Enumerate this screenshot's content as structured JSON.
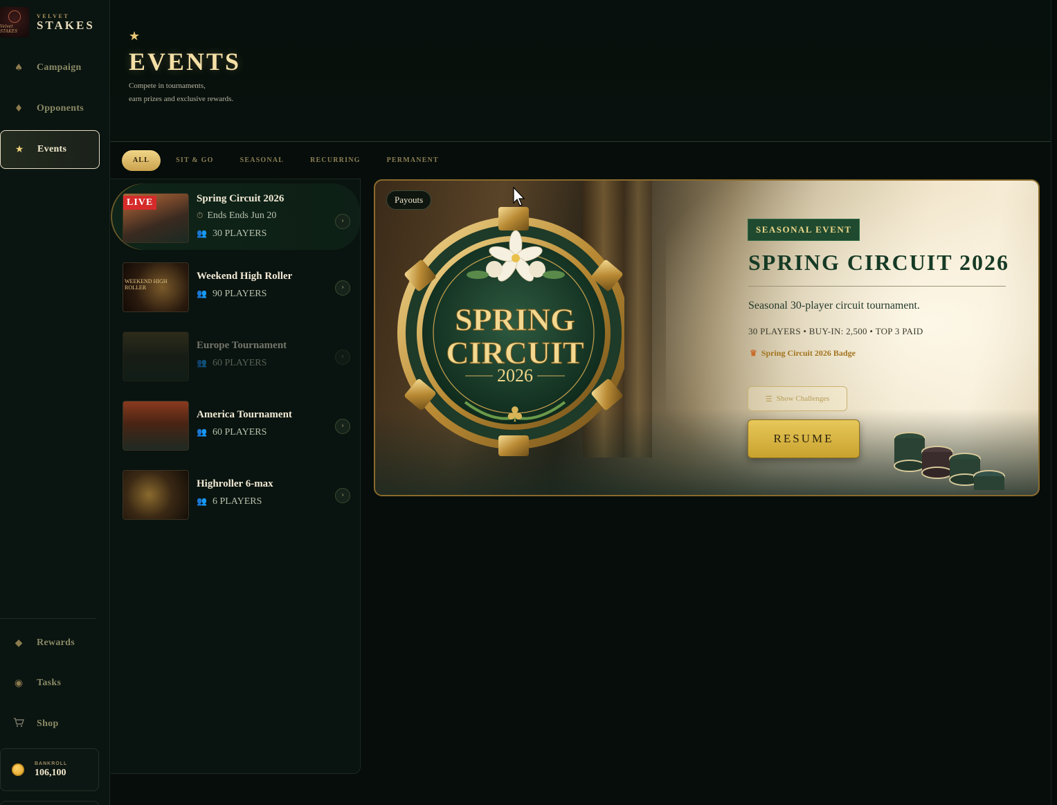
{
  "brand": {
    "sub": "VELVET",
    "main": "STAKES",
    "logo_text": "Velvet STAKES"
  },
  "nav": {
    "top": [
      {
        "label": "Campaign",
        "icon": "spade-icon"
      },
      {
        "label": "Opponents",
        "icon": "diamond-icon"
      },
      {
        "label": "Events",
        "icon": "star-icon",
        "active": true
      }
    ],
    "bottom": [
      {
        "label": "Rewards",
        "icon": "gem-icon"
      },
      {
        "label": "Tasks",
        "icon": "target-icon"
      },
      {
        "label": "Shop",
        "icon": "cart-icon"
      }
    ]
  },
  "bankroll": {
    "label": "BANKROLL",
    "value": "106,100"
  },
  "header": {
    "title": "EVENTS",
    "subtitle_line1": "Compete in tournaments,",
    "subtitle_line2": "earn prizes and exclusive rewards."
  },
  "tabs": [
    {
      "label": "ALL",
      "active": true
    },
    {
      "label": "SIT & GO"
    },
    {
      "label": "SEASONAL"
    },
    {
      "label": "RECURRING"
    },
    {
      "label": "PERMANENT"
    }
  ],
  "events": [
    {
      "name": "Spring Circuit 2026",
      "ends": "Ends Ends Jun 20",
      "players": "30 PLAYERS",
      "live": "LIVE",
      "active": true
    },
    {
      "name": "Weekend High Roller",
      "players": "90 PLAYERS",
      "thumb_text": "WEEKEND HIGH ROLLER"
    },
    {
      "name": "Europe Tournament",
      "players": "60 PLAYERS",
      "dimmed": true
    },
    {
      "name": "America Tournament",
      "players": "60 PLAYERS"
    },
    {
      "name": "Highroller 6-max",
      "players": "6 PLAYERS"
    }
  ],
  "hero": {
    "payouts_label": "Payouts",
    "tag": "SEASONAL EVENT",
    "title": "SPRING CIRCUIT 2026",
    "description": "Seasonal 30-player circuit tournament.",
    "stats": "30 PLAYERS • BUY-IN: 2,500 • TOP 3 PAID",
    "badge": "Spring Circuit 2026 Badge",
    "medal_line1": "SPRING",
    "medal_line2": "CIRCUIT",
    "medal_year": "2026",
    "challenges_label": "Show Challenges",
    "resume_label": "RESUME"
  },
  "colors": {
    "accent_gold": "#e7c85a",
    "live_red": "#d62b2b",
    "seasonal_green": "#1f4a30"
  }
}
